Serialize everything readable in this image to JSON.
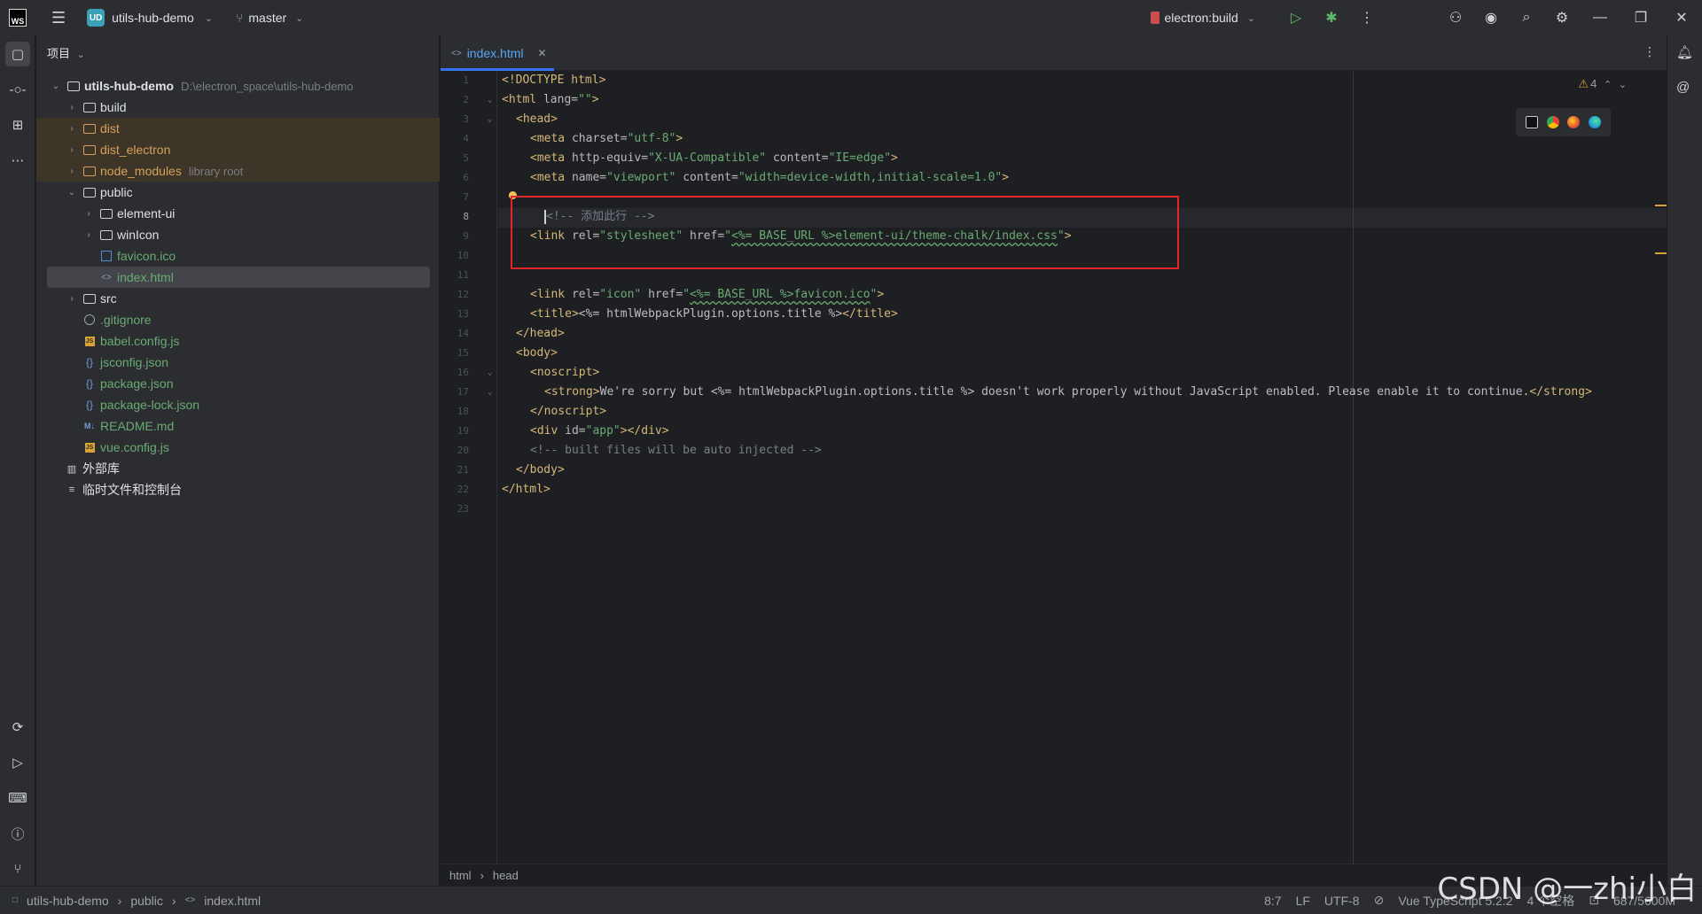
{
  "titlebar": {
    "logo": "WS",
    "project_badge": "UD",
    "project_name": "utils-hub-demo",
    "branch": "master",
    "run_config": "electron:build"
  },
  "project_panel": {
    "header": "项目",
    "root_name": "utils-hub-demo",
    "root_path": "D:\\electron_space\\utils-hub-demo",
    "items": [
      {
        "label": "build"
      },
      {
        "label": "dist"
      },
      {
        "label": "dist_electron"
      },
      {
        "label": "node_modules",
        "note": "library root"
      },
      {
        "label": "public"
      },
      {
        "label": "element-ui"
      },
      {
        "label": "winIcon"
      },
      {
        "label": "favicon.ico"
      },
      {
        "label": "index.html"
      },
      {
        "label": "src"
      },
      {
        "label": ".gitignore"
      },
      {
        "label": "babel.config.js"
      },
      {
        "label": "jsconfig.json"
      },
      {
        "label": "package.json"
      },
      {
        "label": "package-lock.json"
      },
      {
        "label": "README.md"
      },
      {
        "label": "vue.config.js"
      },
      {
        "label": "外部库"
      },
      {
        "label": "临时文件和控制台"
      }
    ]
  },
  "editor": {
    "tab_label": "index.html",
    "warning_count": "4",
    "line_numbers": [
      "1",
      "2",
      "3",
      "4",
      "5",
      "6",
      "7",
      "8",
      "9",
      "10",
      "11",
      "12",
      "13",
      "14",
      "15",
      "16",
      "17",
      "18",
      "19",
      "20",
      "21",
      "22",
      "23"
    ],
    "code": {
      "l1": "<!DOCTYPE html>",
      "l2_tag": "<html ",
      "l2_attr": "lang=",
      "l2_val": "\"\"",
      "l2_end": ">",
      "l3": "<head>",
      "l4_tag": "<meta ",
      "l4_attr": "charset=",
      "l4_val": "\"utf-8\"",
      "l5_tag": "<meta ",
      "l5_attr1": "http-equiv=",
      "l5_val1": "\"X-UA-Compatible\"",
      "l5_attr2": " content=",
      "l5_val2": "\"IE=edge\"",
      "l6_tag": "<meta ",
      "l6_attr1": "name=",
      "l6_val1": "\"viewport\"",
      "l6_attr2": " content=",
      "l6_val2": "\"width=device-width,initial-scale=1.0\"",
      "l8": "<!-- 添加此行 -->",
      "l9_tag": "<link ",
      "l9_attr1": "rel=",
      "l9_val1": "\"stylesheet\"",
      "l9_attr2": " href=",
      "l9_q": "\"",
      "l9_val2": "<%= BASE_URL %>element-ui/theme-chalk/index.css",
      "l12_tag": "<link ",
      "l12_attr1": "rel=",
      "l12_val1": "\"icon\"",
      "l12_attr2": " href=",
      "l12_val2": "<%= BASE_URL %>favicon.ico",
      "l13_open": "<title>",
      "l13_text": "<%= htmlWebpackPlugin.options.title %>",
      "l13_close": "</title>",
      "l14": "</head>",
      "l15": "<body>",
      "l16": "<noscript>",
      "l17_open": "<strong>",
      "l17_text": "We're sorry but <%= htmlWebpackPlugin.options.title %> doesn't work properly without JavaScript enabled. Please enable it to continue.",
      "l17_close": "</strong>",
      "l18": "</noscript>",
      "l19_tag": "<div ",
      "l19_attr": "id=",
      "l19_val": "\"app\"",
      "l19_end": "></div>",
      "l20": "<!-- built files will be auto injected -->",
      "l21": "</body>",
      "l22": "</html>"
    }
  },
  "breadcrumb_bar": [
    "html",
    "head"
  ],
  "statusbar": {
    "path": [
      "utils-hub-demo",
      "public",
      "index.html"
    ],
    "position": "8:7",
    "line_sep": "LF",
    "encoding": "UTF-8",
    "language": "Vue TypeScript 5.2.2",
    "indent": "4 个空格",
    "memory": "687/5600M"
  },
  "watermark": "CSDN @一zhi小白",
  "colors": {
    "accent": "#3574f0",
    "highlight_box": "#e0262a",
    "excluded_folder": "#d6a25a",
    "string": "#6aab73",
    "tag": "#d5b778"
  }
}
